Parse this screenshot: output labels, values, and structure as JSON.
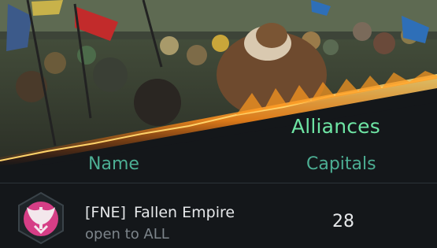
{
  "header": {
    "title": "Alliances"
  },
  "table": {
    "columns": {
      "name": "Name",
      "capitals": "Capitals"
    },
    "rows": [
      {
        "tag": "[FNE]",
        "name": "Fallen Empire",
        "status": "open to ALL",
        "capitals": "28",
        "emblem_icon": "winged-emblem-icon",
        "emblem_color": "#d63e86"
      }
    ]
  },
  "colors": {
    "accent": "#6ee5a4",
    "header_text": "#4cae93",
    "background": "#14171a",
    "fire": "#ff9a1f"
  }
}
